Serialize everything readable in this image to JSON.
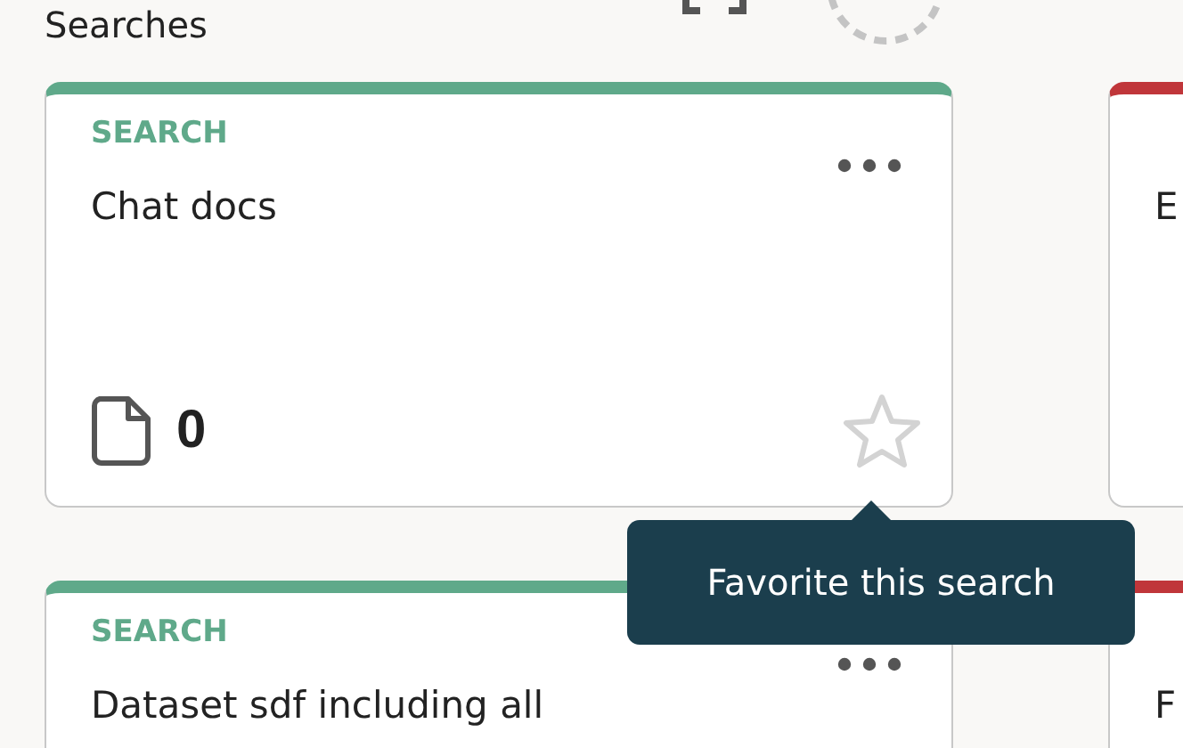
{
  "header": {
    "title": "Searches"
  },
  "columns": [
    {
      "cards": [
        {
          "color": "#5fa98a",
          "label": "SEARCH",
          "title": "Chat docs",
          "count": "0",
          "favorite": false
        },
        {
          "color": "#5fa98a",
          "label": "SEARCH",
          "title": "Dataset sdf including all"
        }
      ]
    },
    {
      "cards": [
        {
          "color": "#c0363a",
          "title": "E"
        },
        {
          "color": "#c0363a",
          "title": "F"
        }
      ]
    }
  ],
  "tooltip": {
    "text": "Favorite this search"
  }
}
